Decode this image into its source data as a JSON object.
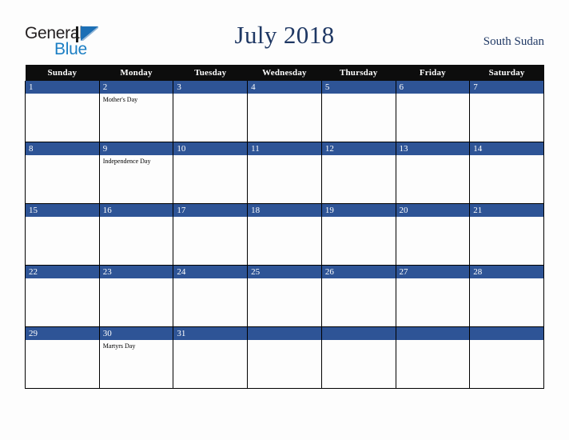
{
  "brand": {
    "name_part1": "General",
    "name_part2": "Blue",
    "mark": "triangle-logo-icon",
    "color_dark": "#231f20",
    "color_blue": "#1c7fc4"
  },
  "header": {
    "title": "July 2018",
    "country": "South Sudan",
    "title_color": "#1f3864"
  },
  "calendar": {
    "month": "July",
    "year": "2018",
    "weekday_headers": [
      "Sunday",
      "Monday",
      "Tuesday",
      "Wednesday",
      "Thursday",
      "Friday",
      "Saturday"
    ],
    "header_bg": "#0d0d0d",
    "daynum_bg": "#2e5496",
    "cell_bg": "#fdfdfd",
    "grid_color": "#000000",
    "weeks": [
      [
        {
          "day": "1",
          "event": ""
        },
        {
          "day": "2",
          "event": "Mother's Day"
        },
        {
          "day": "3",
          "event": ""
        },
        {
          "day": "4",
          "event": ""
        },
        {
          "day": "5",
          "event": ""
        },
        {
          "day": "6",
          "event": ""
        },
        {
          "day": "7",
          "event": ""
        }
      ],
      [
        {
          "day": "8",
          "event": ""
        },
        {
          "day": "9",
          "event": "Independence Day"
        },
        {
          "day": "10",
          "event": ""
        },
        {
          "day": "11",
          "event": ""
        },
        {
          "day": "12",
          "event": ""
        },
        {
          "day": "13",
          "event": ""
        },
        {
          "day": "14",
          "event": ""
        }
      ],
      [
        {
          "day": "15",
          "event": ""
        },
        {
          "day": "16",
          "event": ""
        },
        {
          "day": "17",
          "event": ""
        },
        {
          "day": "18",
          "event": ""
        },
        {
          "day": "19",
          "event": ""
        },
        {
          "day": "20",
          "event": ""
        },
        {
          "day": "21",
          "event": ""
        }
      ],
      [
        {
          "day": "22",
          "event": ""
        },
        {
          "day": "23",
          "event": ""
        },
        {
          "day": "24",
          "event": ""
        },
        {
          "day": "25",
          "event": ""
        },
        {
          "day": "26",
          "event": ""
        },
        {
          "day": "27",
          "event": ""
        },
        {
          "day": "28",
          "event": ""
        }
      ],
      [
        {
          "day": "29",
          "event": ""
        },
        {
          "day": "30",
          "event": "Martyrs Day"
        },
        {
          "day": "31",
          "event": ""
        },
        {
          "day": "",
          "event": ""
        },
        {
          "day": "",
          "event": ""
        },
        {
          "day": "",
          "event": ""
        },
        {
          "day": "",
          "event": ""
        }
      ]
    ]
  }
}
